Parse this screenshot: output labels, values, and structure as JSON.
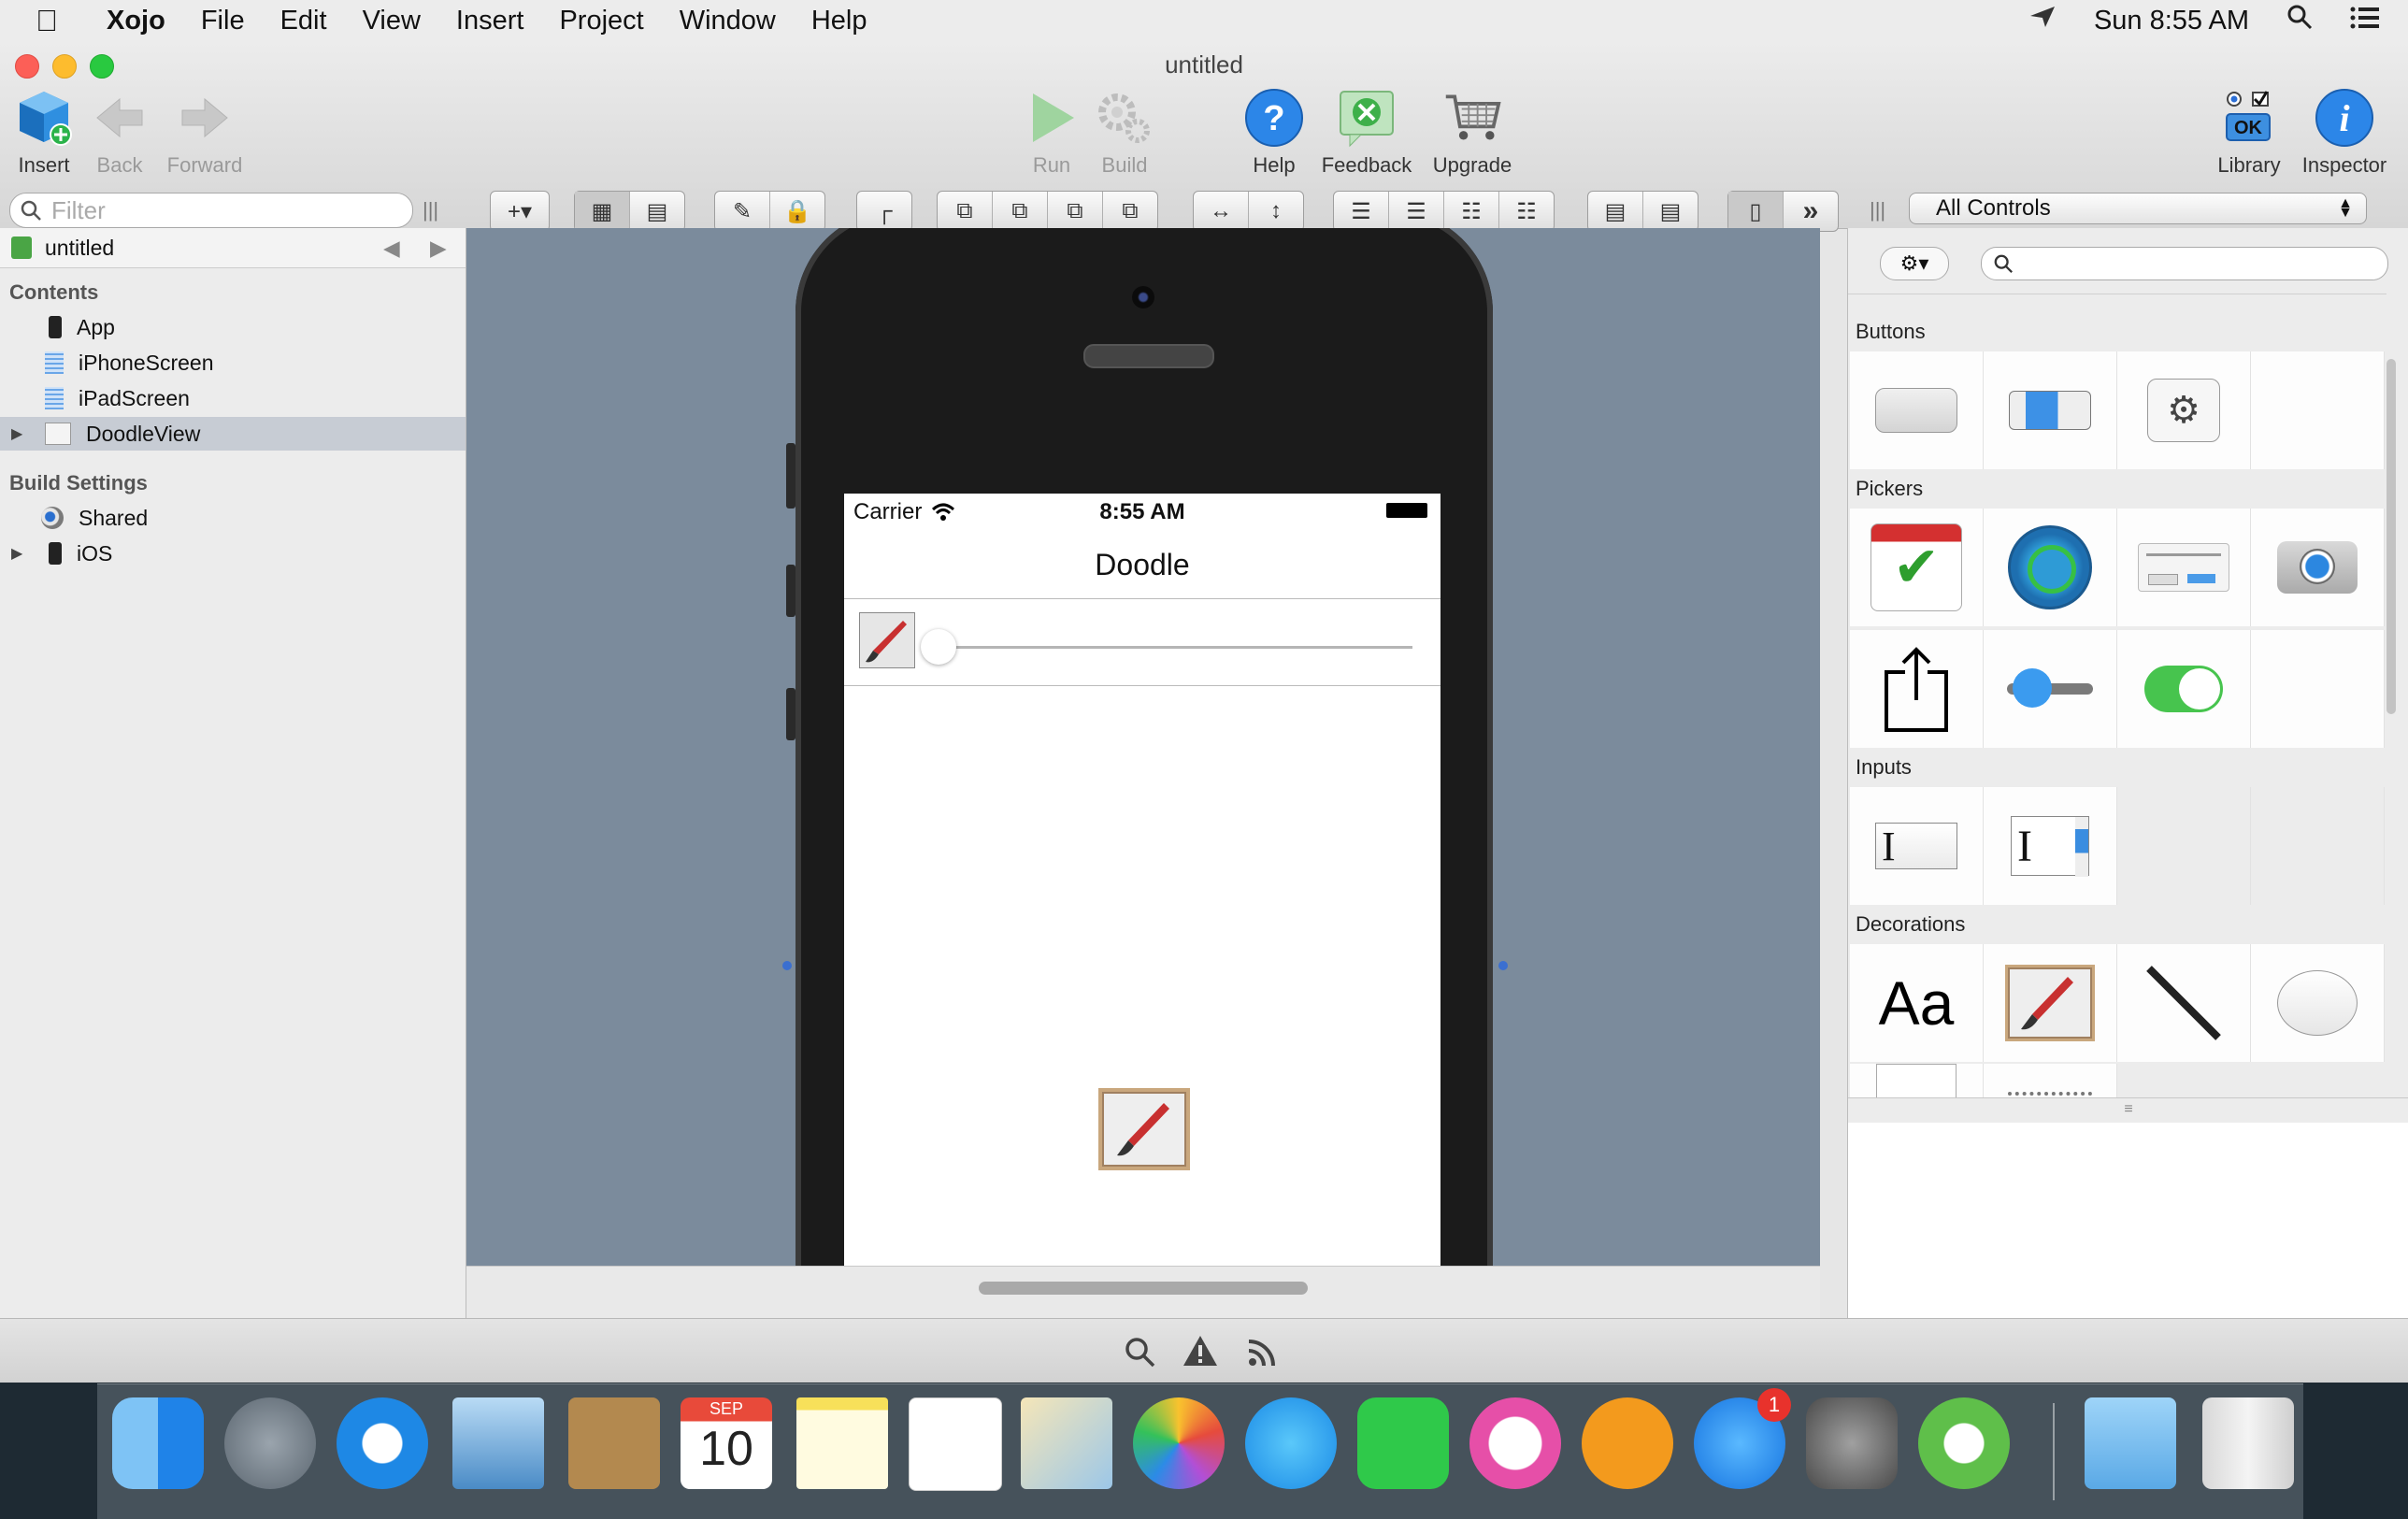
{
  "menubar": {
    "apple": "",
    "app": "Xojo",
    "items": [
      "File",
      "Edit",
      "View",
      "Insert",
      "Project",
      "Window",
      "Help"
    ],
    "clock": "Sun 8:55 AM"
  },
  "window": {
    "title": "untitled",
    "toolbar": {
      "insert": "Insert",
      "back": "Back",
      "forward": "Forward",
      "run": "Run",
      "build": "Build",
      "help": "Help",
      "feedback": "Feedback",
      "upgrade": "Upgrade",
      "library": "Library",
      "inspector": "Inspector"
    },
    "filter_placeholder": "Filter",
    "controls_select": "All Controls"
  },
  "navigator": {
    "project": "untitled",
    "contents_header": "Contents",
    "contents": [
      "App",
      "iPhoneScreen",
      "iPadScreen",
      "DoodleView"
    ],
    "build_header": "Build Settings",
    "build": [
      "Shared",
      "iOS"
    ]
  },
  "device": {
    "carrier": "Carrier",
    "time": "8:55 AM",
    "nav_title": "Doodle"
  },
  "library": {
    "sections": [
      "Buttons",
      "Pickers",
      "Inputs",
      "Decorations"
    ],
    "label_sample": "Aa"
  },
  "dock": {
    "calendar_month": "SEP",
    "calendar_day": "10",
    "appstore_badge": "1"
  },
  "colors": {
    "accent": "#2c86e8",
    "canvas": "#7b8b9c",
    "selection": "#c7ccd4"
  }
}
